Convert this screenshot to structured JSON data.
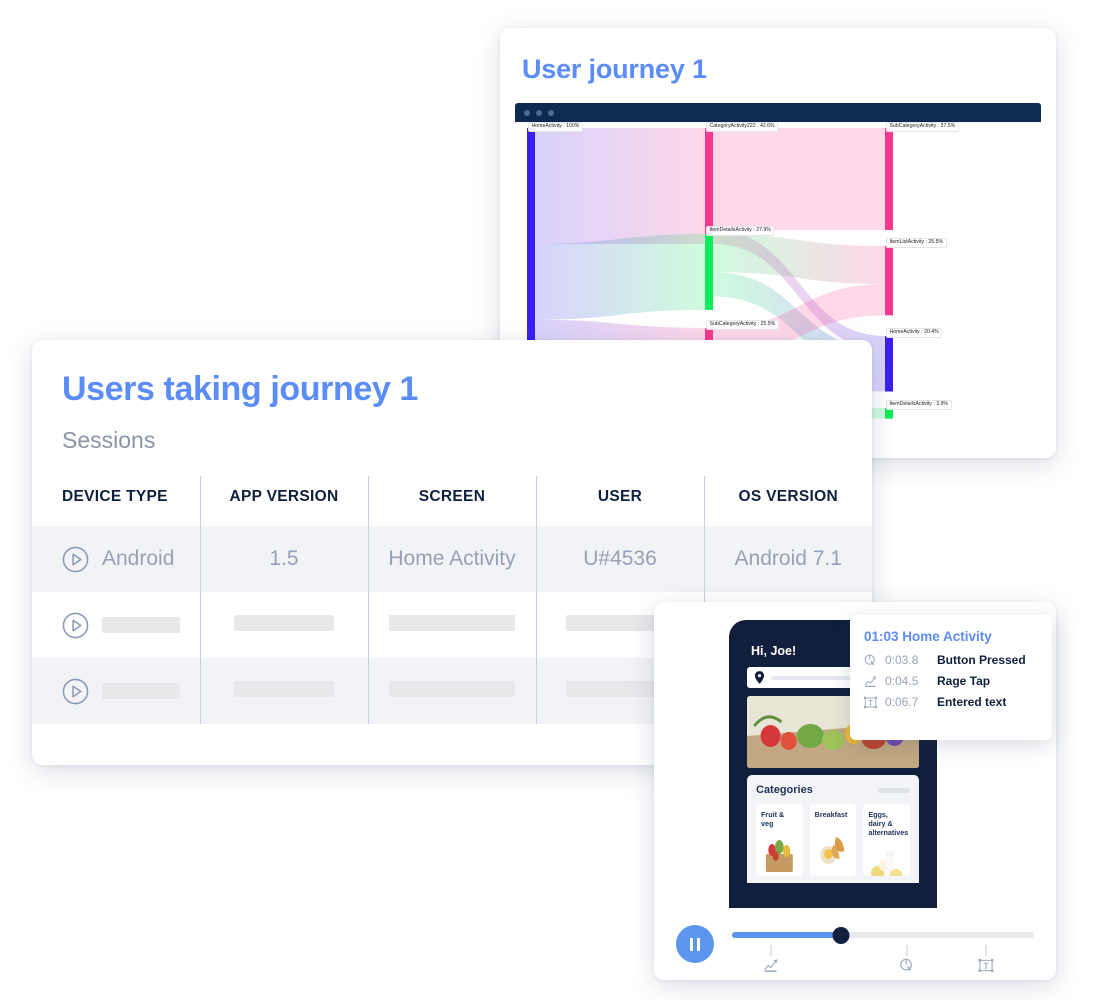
{
  "journey": {
    "title": "User journey 1",
    "browser_dots": 3,
    "sankey": {
      "type": "sankey",
      "columns": 3,
      "nodes": [
        {
          "id": "n0",
          "label": "HomeActivity : 100%",
          "name": "HomeActivity",
          "value": 100.0,
          "column": 0,
          "color": "#3a1ff0"
        },
        {
          "id": "n1",
          "label": "CategoryActivity222 : 42.6%",
          "name": "CategoryActivity222",
          "value": 42.6,
          "column": 1,
          "color": "#f8388f"
        },
        {
          "id": "n2",
          "label": "ItemDetailsActivity : 27.9%",
          "name": "ItemDetailsActivity",
          "value": 27.9,
          "column": 1,
          "color": "#0bec5a"
        },
        {
          "id": "n3",
          "label": "SubCategoryActivity : 25.5%",
          "name": "SubCategoryActivity",
          "value": 25.5,
          "column": 1,
          "color": "#f8388f"
        },
        {
          "id": "n4",
          "label": "SubCategoryActivity : 37.5%",
          "name": "SubCategoryActivity",
          "value": 37.5,
          "column": 2,
          "color": "#f8388f"
        },
        {
          "id": "n5",
          "label": "ItemListActivity : 25.5%",
          "name": "ItemListActivity",
          "value": 25.5,
          "column": 2,
          "color": "#f8388f"
        },
        {
          "id": "n6",
          "label": "HomeActivity : 20.4%",
          "name": "HomeActivity",
          "value": 20.4,
          "column": 2,
          "color": "#3a1ff0"
        },
        {
          "id": "n7",
          "label": "ItemDetailsActivity : 3.9%",
          "name": "ItemDetailsActivity",
          "value": 3.9,
          "column": 2,
          "color": "#0bec5a"
        }
      ],
      "links": [
        {
          "source": "n0",
          "target": "n1",
          "value": 42.6
        },
        {
          "source": "n0",
          "target": "n2",
          "value": 27.9
        },
        {
          "source": "n0",
          "target": "n3",
          "value": 25.5
        },
        {
          "source": "n1",
          "target": "n4",
          "value": 37.5
        },
        {
          "source": "n1",
          "target": "n6",
          "value": 5.1
        },
        {
          "source": "n2",
          "target": "n5",
          "value": 14.0
        },
        {
          "source": "n2",
          "target": "n6",
          "value": 9.0
        },
        {
          "source": "n3",
          "target": "n5",
          "value": 11.5
        },
        {
          "source": "n3",
          "target": "n6",
          "value": 6.3
        },
        {
          "source": "n3",
          "target": "n7",
          "value": 3.9
        }
      ]
    }
  },
  "users": {
    "title": "Users taking journey 1",
    "subtitle": "Sessions",
    "columns": [
      "DEVICE TYPE",
      "APP VERSION",
      "SCREEN",
      "USER",
      "OS VERSION"
    ],
    "rows": [
      {
        "device_type": "Android",
        "app_version": "1.5",
        "screen": "Home Activity",
        "user": "U#4536",
        "os_version": "Android 7.1",
        "loaded": true
      },
      {
        "loaded": false
      },
      {
        "loaded": false
      }
    ]
  },
  "player": {
    "phone": {
      "greeting": "Hi, Joe!",
      "search_placeholder": "",
      "categories_title": "Categories",
      "categories": [
        {
          "label": "Fruit & veg"
        },
        {
          "label": "Breakfast"
        },
        {
          "label": "Eggs, dairy & alternatives"
        }
      ]
    },
    "tooltip": {
      "title": "01:03 Home Activity",
      "events": [
        {
          "time": "0:03.8",
          "label": "Button Pressed",
          "icon": "tap-icon"
        },
        {
          "time": "0:04.5",
          "label": "Rage Tap",
          "icon": "rage-tap-icon"
        },
        {
          "time": "0:06.7",
          "label": "Entered text",
          "icon": "text-input-icon"
        }
      ]
    },
    "controls": {
      "state": "playing",
      "progress_percent": 36,
      "markers": [
        {
          "position_percent": 13,
          "icon": "rage-tap-icon"
        },
        {
          "position_percent": 58,
          "icon": "tap-icon"
        },
        {
          "position_percent": 84,
          "icon": "text-input-icon"
        }
      ]
    }
  },
  "colors": {
    "accent": "#5b8cf7",
    "dark": "#10203c",
    "muted": "#97a0b4",
    "node_blue": "#3a1ff0",
    "node_pink": "#f8388f",
    "node_green": "#0bec5a"
  }
}
